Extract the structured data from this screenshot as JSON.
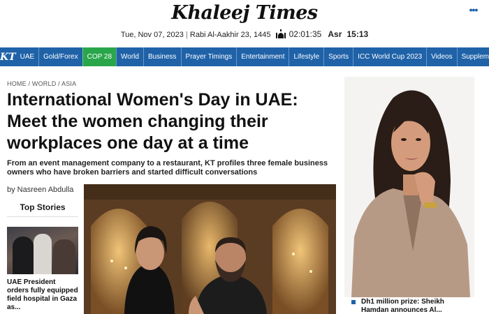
{
  "masthead": {
    "logo": "Khaleej Times",
    "date": "Tue, Nov 07, 2023",
    "hijri": "Rabi Al-Aakhir 23, 1445",
    "clock": "02:01:35",
    "prayer_label": "Asr",
    "prayer_time": "15:13",
    "prayer_icon": "mosque-icon"
  },
  "nav": {
    "logo": "KT",
    "items": [
      "UAE",
      "Gold/Forex",
      "COP 28",
      "World",
      "Business",
      "Prayer Timings",
      "Entertainment",
      "Lifestyle",
      "Sports",
      "ICC World Cup 2023",
      "Videos",
      "Supplements"
    ],
    "active_item": "COP 28",
    "more": "•••",
    "colors": {
      "bar": "#1f62a8",
      "active": "#2aa64a"
    }
  },
  "article": {
    "breadcrumb": "HOME / WORLD / ASIA",
    "headline": "International Women's Day in UAE: Meet the women changing their workplaces one day at a time",
    "subhead": "From an event management company to a restaurant, KT profiles three female business owners who have broken barriers and started difficult conversations",
    "byline": "by Nasreen Abdulla"
  },
  "top_stories": {
    "title": "Top Stories",
    "items": [
      {
        "text": "UAE President orders fully equipped field hospital in Gaza as..."
      }
    ]
  },
  "side_story": {
    "text": "Dh1 million prize: Sheikh Hamdan announces Al..."
  }
}
